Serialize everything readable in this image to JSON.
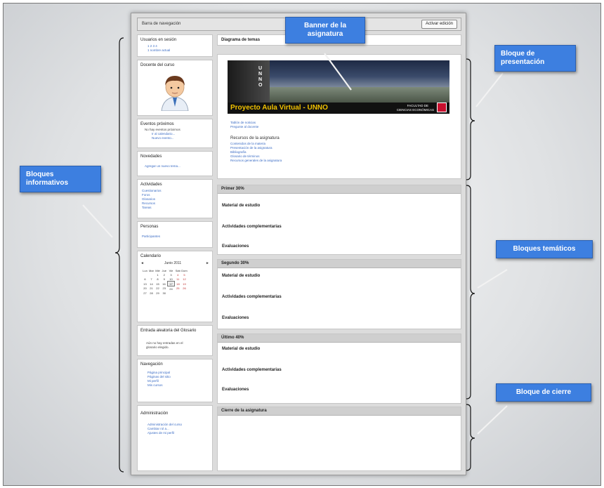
{
  "navbar": {
    "title": "Barra de navegación",
    "edit_button": "Activar edición"
  },
  "left_blocks": {
    "session_users": {
      "title": "Usuarios en sesión",
      "lines": [
        "1 2 3 4",
        "1 nombre actual"
      ]
    },
    "teacher": {
      "title": "Docente del curso"
    },
    "events": {
      "title": "Eventos próximos",
      "lines": [
        "No hay eventos próximos",
        "Ir al calendario...",
        "Nuevo evento..."
      ]
    },
    "news": {
      "title": "Novedades",
      "lines": [
        "Agregar un nuevo tema..."
      ]
    },
    "activities": {
      "title": "Actividades",
      "items": [
        "Cuestionarios",
        "Foros",
        "Glosarios",
        "Recursos",
        "Tareas"
      ]
    },
    "people": {
      "title": "Personas",
      "items": [
        "Participantes"
      ]
    },
    "calendar": {
      "title": "Calendario",
      "month": "Junio 2011",
      "prev": "◄",
      "next": "►",
      "weekdays": [
        "Lun",
        "Mar",
        "Mié",
        "Jue",
        "Vie",
        "Sáb",
        "Dom"
      ],
      "rows": [
        [
          "",
          "",
          "1",
          "2",
          "3",
          "4",
          "5"
        ],
        [
          "6",
          "7",
          "8",
          "9",
          "10",
          "11",
          "12"
        ],
        [
          "13",
          "14",
          "15",
          "16",
          "17",
          "18",
          "19"
        ],
        [
          "20",
          "21",
          "22",
          "23",
          "24",
          "25",
          "26"
        ],
        [
          "27",
          "28",
          "29",
          "30",
          "",
          "",
          ""
        ]
      ]
    },
    "glossary": {
      "title": "Entrada aleatoria del Glosario",
      "lines": [
        "Aún no hay entradas en el",
        "glosario elegido."
      ]
    },
    "navigation": {
      "title": "Navegación",
      "items": [
        "Página principal",
        "Páginas del sitio",
        "Mi perfil",
        "Mis cursos"
      ]
    },
    "admin": {
      "title": "Administración",
      "items": [
        "Administración del curso",
        "Cambiar rol a...",
        "Ajustes de mi perfil"
      ]
    }
  },
  "main": {
    "topics_diagram": "Diagrama de temas",
    "banner": {
      "title": "Proyecto Aula Virtual - UNNO",
      "brand_lines": [
        "FACULTAD DE",
        "CIENCIAS ECONÓMICAS"
      ],
      "side_text": "UNNO"
    },
    "presentation_links": [
      "Tablón de noticias",
      "Pregunte al docente"
    ],
    "resources_title": "Recursos de la asignatura",
    "resources_links": [
      "Contenidos de la materia",
      "Presentación de la asignatura",
      "Bibliografía",
      "Glosario de términos",
      "Recursos generales de la asignatura"
    ],
    "sections": [
      {
        "title": "Primer 30%",
        "items": [
          "Material de estudio",
          "Actividades complementarias",
          "Evaluaciones"
        ]
      },
      {
        "title": "Segundo 30%",
        "items": [
          "Material de estudio",
          "Actividades complementarias",
          "Evaluaciones"
        ]
      },
      {
        "title": "Último 40%",
        "items": [
          "Material de estudio",
          "Actividades complementarias",
          "Evaluaciones"
        ]
      }
    ],
    "closing": "Cierre de la asignatura"
  },
  "annotations": {
    "banner": "Banner de la asignatura",
    "presentation": "Bloque de presentación",
    "info": "Bloques informativos",
    "thematic": "Bloques temáticos",
    "closing": "Bloque de cierre"
  },
  "colors": {
    "annotation_blue": "#3d7fe0",
    "link_blue": "#3b6cc4",
    "section_header_gray": "#cfcfcf"
  }
}
